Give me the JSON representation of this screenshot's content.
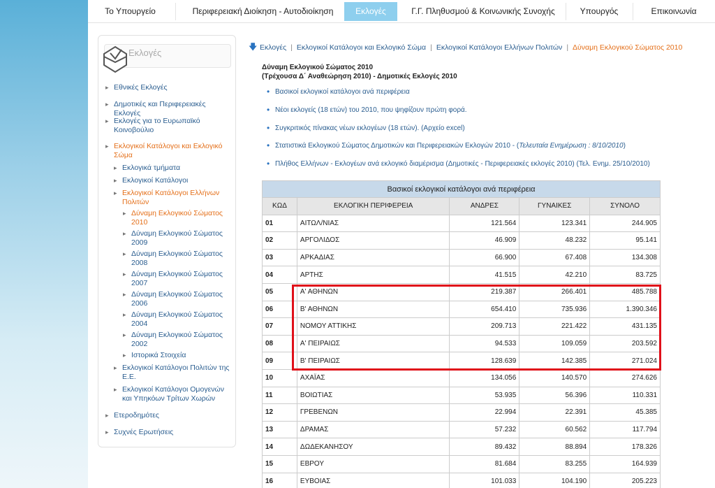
{
  "nav": {
    "items": [
      {
        "label": "Το Υπουργείο"
      },
      {
        "label": "Περιφερειακή Διοίκηση - Αυτοδιοίκηση"
      },
      {
        "label": "Εκλογές",
        "active": true
      },
      {
        "label": "Γ.Γ. Πληθυσμού & Κοινωνικής Συνοχής"
      },
      {
        "label": "Υπουργός"
      },
      {
        "label": "Επικοινωνία"
      }
    ]
  },
  "sidebar": {
    "title": "Εκλογές",
    "items": [
      {
        "label": "Εθνικές Εκλογές"
      },
      {
        "label": "Δημοτικές και Περιφερειακές Εκλογές"
      },
      {
        "label": "Εκλογές για το Ευρωπαϊκό Κοινοβούλιο"
      },
      {
        "label": "Εκλογικοί Κατάλογοι και Εκλογικό Σώμα",
        "active": true
      },
      {
        "label": "Εκλογικά τμήματα"
      },
      {
        "label": "Εκλογικοί Κατάλογοι"
      },
      {
        "label": "Εκλογικοί Κατάλογοι Ελλήνων Πολιτών",
        "active": true
      },
      {
        "label": "Δύναμη Εκλογικού Σώματος 2010",
        "active": true
      },
      {
        "label": "Δύναμη Εκλογικού Σώματος 2009"
      },
      {
        "label": "Δύναμη Εκλογικού Σώματος 2008"
      },
      {
        "label": "Δύναμη Εκλογικού Σώματος 2007"
      },
      {
        "label": "Δύναμη Εκλογικού Σώματος 2006"
      },
      {
        "label": "Δύναμη Εκλογικού Σώματος 2004"
      },
      {
        "label": "Δύναμη Εκλογικού Σώματος 2002"
      },
      {
        "label": "Ιστορικά Στοιχεία"
      },
      {
        "label": "Εκλογικοί Κατάλογοι Πολιτών της Ε.Ε."
      },
      {
        "label": "Εκλογικοί Κατάλογοι Ομογενών και Υπηκόων Τρίτων Χωρών"
      },
      {
        "label": "Ετεροδημότες"
      },
      {
        "label": "Συχνές Ερωτήσεις"
      }
    ]
  },
  "breadcrumb": [
    "Εκλογές",
    "Εκλογικοί Κατάλογοι και Εκλογικό Σώμα",
    "Εκλογικοί Κατάλογοι Ελλήνων Πολιτών",
    "Δύναμη Εκλογικού Σώματος 2010"
  ],
  "heading": {
    "line1": "Δύναμη Εκλογικού Σώματος 2010",
    "line2": "(Τρέχουσα Δ΄ Αναθεώρηση 2010) - Δημοτικές Εκλογές 2010"
  },
  "links": [
    {
      "text": "Βασικοί εκλογικοί κατάλογοι ανά περιφέρεια"
    },
    {
      "text": "Νέοι εκλογείς (18 ετών) του 2010, που ψηφίζουν πρώτη φορά."
    },
    {
      "text": "Συγκριτικός πίνακας νέων εκλογέων (18 ετών). (Αρχείο excel)"
    },
    {
      "text": "Στατιστικά Εκλογικού Σώματος Δημοτικών και Περιφερειακών Εκλογών 2010 - (",
      "italic": "Τελευταία Ενημέρωση : 8/10/2010",
      "suffix": ")"
    },
    {
      "text": "Πλήθος Ελλήνων - Εκλογέων ανά εκλογικό διαμέρισμα (Δημοτικές - Περιφερειακές εκλογές 2010) (Τελ. Ενημ. 25/10/2010)"
    }
  ],
  "table": {
    "caption": "Βασικοί εκλογικοί κατάλογοι ανά περιφέρεια",
    "headers": [
      "ΚΩΔ",
      "ΕΚΛΟΓΙΚΗ ΠΕΡΙΦΕΡΕΙΑ",
      "ΑΝΔΡΕΣ",
      "ΓΥΝΑΙΚΕΣ",
      "ΣΥΝΟΛΟ"
    ],
    "rows": [
      [
        "01",
        "ΑΙΤΩΛ/ΝΙΑΣ",
        "121.564",
        "123.341",
        "244.905"
      ],
      [
        "02",
        "ΑΡΓΟΛΙΔΟΣ",
        "46.909",
        "48.232",
        "95.141"
      ],
      [
        "03",
        "ΑΡΚΑΔΙΑΣ",
        "66.900",
        "67.408",
        "134.308"
      ],
      [
        "04",
        "ΑΡΤΗΣ",
        "41.515",
        "42.210",
        "83.725"
      ],
      [
        "05",
        "Α' ΑΘΗΝΩΝ",
        "219.387",
        "266.401",
        "485.788"
      ],
      [
        "06",
        "Β' ΑΘΗΝΩΝ",
        "654.410",
        "735.936",
        "1.390.346"
      ],
      [
        "07",
        "ΝΟΜΟΥ ΑΤΤΙΚΗΣ",
        "209.713",
        "221.422",
        "431.135"
      ],
      [
        "08",
        "Α' ΠΕΙΡΑΙΩΣ",
        "94.533",
        "109.059",
        "203.592"
      ],
      [
        "09",
        "Β' ΠΕΙΡΑΙΩΣ",
        "128.639",
        "142.385",
        "271.024"
      ],
      [
        "10",
        "ΑΧΑΪΑΣ",
        "134.056",
        "140.570",
        "274.626"
      ],
      [
        "11",
        "ΒΟΙΩΤΙΑΣ",
        "53.935",
        "56.396",
        "110.331"
      ],
      [
        "12",
        "ΓΡΕΒΕΝΩΝ",
        "22.994",
        "22.391",
        "45.385"
      ],
      [
        "13",
        "ΔΡΑΜΑΣ",
        "57.232",
        "60.562",
        "117.794"
      ],
      [
        "14",
        "ΔΩΔΕΚΑΝΗΣΟΥ",
        "89.432",
        "88.894",
        "178.326"
      ],
      [
        "15",
        "ΕΒΡΟΥ",
        "81.684",
        "83.255",
        "164.939"
      ],
      [
        "16",
        "ΕΥΒΟΙΑΣ",
        "101.033",
        "104.190",
        "205.223"
      ]
    ]
  },
  "colors": {
    "link": "#2a5d8f",
    "active_link": "#e46f19",
    "nav_active": "#8ecfee",
    "highlight": "#e0101a"
  }
}
